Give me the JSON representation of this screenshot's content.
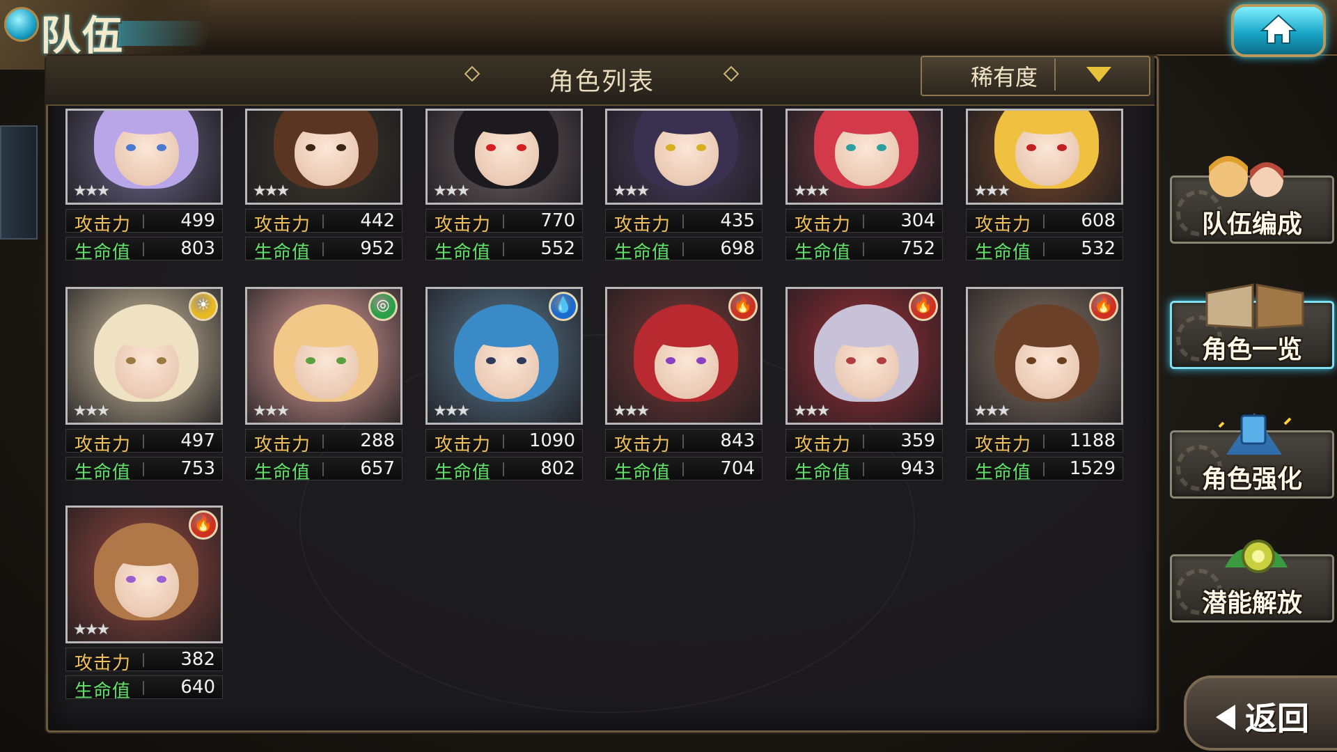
{
  "header": {
    "title": "队伍"
  },
  "list": {
    "title": "角色列表",
    "sort_label": "稀有度"
  },
  "stat_labels": {
    "attack": "攻击力",
    "hp": "生命值"
  },
  "characters": [
    {
      "attack": "499",
      "hp": "803",
      "element": "",
      "stars": "★★★",
      "hair": "#b9a6e8",
      "bg": "#6e6a8c",
      "eye": "#4a7ad0"
    },
    {
      "attack": "442",
      "hp": "952",
      "element": "",
      "stars": "★★★",
      "hair": "#5a3522",
      "bg": "#3d3a2c",
      "eye": "#3b2514"
    },
    {
      "attack": "770",
      "hp": "552",
      "element": "",
      "stars": "★★★",
      "hair": "#1c1a1e",
      "bg": "#6b6060",
      "eye": "#d42020"
    },
    {
      "attack": "435",
      "hp": "698",
      "element": "",
      "stars": "★★★",
      "hair": "#3a3050",
      "bg": "#4a3f60",
      "eye": "#d6b020"
    },
    {
      "attack": "304",
      "hp": "752",
      "element": "",
      "stars": "★★★",
      "hair": "#d23a4a",
      "bg": "#7a3a44",
      "eye": "#2aa0a0"
    },
    {
      "attack": "608",
      "hp": "532",
      "element": "",
      "stars": "★★★",
      "hair": "#f0c040",
      "bg": "#7a4a2a",
      "eye": "#c02020"
    },
    {
      "attack": "497",
      "hp": "753",
      "element": "light",
      "stars": "★★★",
      "hair": "#efe2c2",
      "bg": "#d8c9a8",
      "eye": "#9a7a40"
    },
    {
      "attack": "288",
      "hp": "657",
      "element": "wind",
      "stars": "★★★",
      "hair": "#f2c888",
      "bg": "#e8a8a0",
      "eye": "#5aa040"
    },
    {
      "attack": "1090",
      "hp": "802",
      "element": "water",
      "stars": "★★★",
      "hair": "#3a8ac8",
      "bg": "#5a7a90",
      "eye": "#303a5a"
    },
    {
      "attack": "843",
      "hp": "704",
      "element": "fire",
      "stars": "★★★",
      "hair": "#b82a30",
      "bg": "#7a3a38",
      "eye": "#8a40c0"
    },
    {
      "attack": "359",
      "hp": "943",
      "element": "fire",
      "stars": "★★★",
      "hair": "#c8c2d8",
      "bg": "#a03038",
      "eye": "#b04040"
    },
    {
      "attack": "1188",
      "hp": "1529",
      "element": "fire",
      "stars": "★★★",
      "hair": "#6a4028",
      "bg": "#8a7868",
      "eye": "#6a4020"
    },
    {
      "attack": "382",
      "hp": "640",
      "element": "fire",
      "stars": "★★★",
      "hair": "#b07848",
      "bg": "#9a4a40",
      "eye": "#9a60d0"
    }
  ],
  "element_colors": {
    "light": "#e8b820",
    "wind": "#2aa048",
    "water": "#1a6ad0",
    "fire": "#d03020"
  },
  "element_icons": {
    "light": "☀",
    "wind": "◎",
    "water": "💧",
    "fire": "🔥"
  },
  "side_menu": [
    {
      "label": "队伍编成",
      "icon": "team-formation-icon"
    },
    {
      "label": "角色一览",
      "icon": "character-book-icon"
    },
    {
      "label": "角色强化",
      "icon": "enhance-crystal-icon"
    },
    {
      "label": "潜能解放",
      "icon": "potential-orb-icon"
    }
  ],
  "back_label": "返回"
}
